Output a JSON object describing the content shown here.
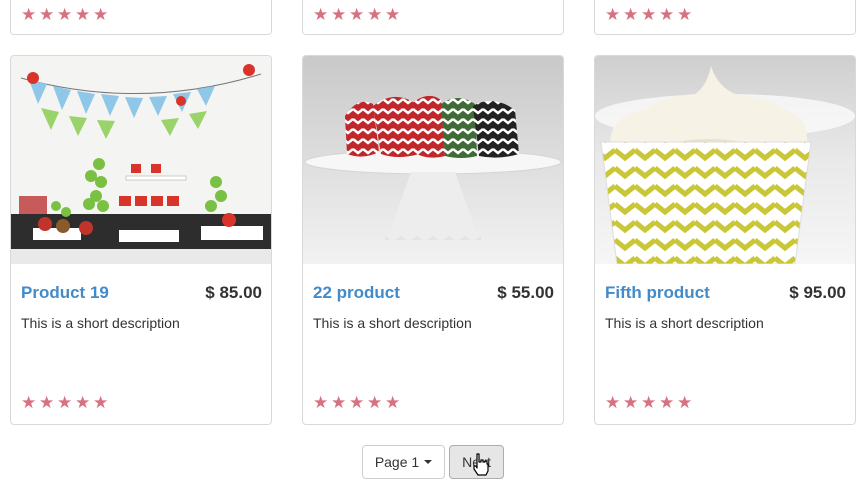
{
  "top_row": {
    "cards": [
      {
        "rating": 5
      },
      {
        "rating": 5
      },
      {
        "rating": 5
      }
    ]
  },
  "products": [
    {
      "title": "Product 19",
      "price": "$ 85.00",
      "description": "This is a short description",
      "rating": 5,
      "image_icon": "party-table-photo"
    },
    {
      "title": "22 product",
      "price": "$ 55.00",
      "description": "This is a short description",
      "rating": 5,
      "image_icon": "chevron-wrappers-photo"
    },
    {
      "title": "Fifth product",
      "price": "$ 95.00",
      "description": "This is a short description",
      "rating": 5,
      "image_icon": "cupcake-photo"
    }
  ],
  "pagination": {
    "page_label": "Page 1",
    "next_label": "Next"
  },
  "colors": {
    "link": "#428bca",
    "star": "#d8707f"
  }
}
